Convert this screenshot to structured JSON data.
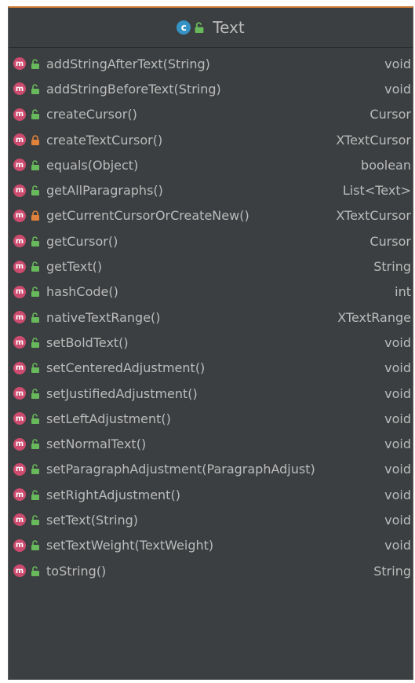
{
  "class": {
    "name": "Text",
    "class_icon_letter": "c",
    "class_icon": "class-icon",
    "visibility_icon": "public-unlock-icon"
  },
  "method_icon_letter": "m",
  "colors": {
    "background": "#3c3f41",
    "text": "#bbbbbb",
    "method_icon": "#cc4b6e",
    "class_icon": "#3592c4",
    "public_icon": "#68b95b",
    "private_icon": "#e0823c"
  },
  "methods": [
    {
      "name": "addStringAfterText(String)",
      "type": "void",
      "visibility": "public"
    },
    {
      "name": "addStringBeforeText(String)",
      "type": "void",
      "visibility": "public"
    },
    {
      "name": "createCursor()",
      "type": "Cursor",
      "visibility": "public"
    },
    {
      "name": "createTextCursor()",
      "type": "XTextCursor",
      "visibility": "private"
    },
    {
      "name": "equals(Object)",
      "type": "boolean",
      "visibility": "public"
    },
    {
      "name": "getAllParagraphs()",
      "type": "List<Text>",
      "visibility": "public"
    },
    {
      "name": "getCurrentCursorOrCreateNew()",
      "type": "XTextCursor",
      "visibility": "private"
    },
    {
      "name": "getCursor()",
      "type": "Cursor",
      "visibility": "public"
    },
    {
      "name": "getText()",
      "type": "String",
      "visibility": "public"
    },
    {
      "name": "hashCode()",
      "type": "int",
      "visibility": "public"
    },
    {
      "name": "nativeTextRange()",
      "type": "XTextRange",
      "visibility": "public"
    },
    {
      "name": "setBoldText()",
      "type": "void",
      "visibility": "public"
    },
    {
      "name": "setCenteredAdjustment()",
      "type": "void",
      "visibility": "public"
    },
    {
      "name": "setJustifiedAdjustment()",
      "type": "void",
      "visibility": "public"
    },
    {
      "name": "setLeftAdjustment()",
      "type": "void",
      "visibility": "public"
    },
    {
      "name": "setNormalText()",
      "type": "void",
      "visibility": "public"
    },
    {
      "name": "setParagraphAdjustment(ParagraphAdjust)",
      "type": "void",
      "visibility": "public"
    },
    {
      "name": "setRightAdjustment()",
      "type": "void",
      "visibility": "public"
    },
    {
      "name": "setText(String)",
      "type": "void",
      "visibility": "public"
    },
    {
      "name": "setTextWeight(TextWeight)",
      "type": "void",
      "visibility": "public"
    },
    {
      "name": "toString()",
      "type": "String",
      "visibility": "public"
    }
  ]
}
